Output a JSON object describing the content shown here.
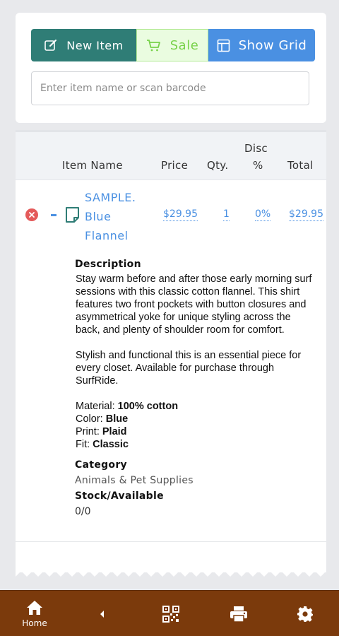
{
  "toolbar": {
    "new_item_label": "New Item",
    "sale_label": "Sale",
    "show_grid_label": "Show Grid"
  },
  "search": {
    "placeholder": "Enter item name or scan barcode"
  },
  "table": {
    "headers": {
      "item_name": "Item Name",
      "price": "Price",
      "qty": "Qty.",
      "disc_line1": "Disc",
      "disc_line2": "%",
      "total": "Total"
    },
    "row": {
      "name_line1": "SAMPLE.",
      "name_line2": "Blue",
      "name_line3": "Flannel",
      "price": "$29.95",
      "qty": "1",
      "discount": "0%",
      "total": "$29.95"
    }
  },
  "details": {
    "description_title": "Description",
    "description_p1": "Stay warm before and after those early morning surf sessions with this classic cotton flannel. This shirt features two front pockets with button closures and asymmetrical yoke for unique styling across the back, and plenty of shoulder room for comfort.",
    "description_p2": "Stylish and functional this is an essential piece for every closet. Available for purchase through SurfRide.",
    "attributes": [
      {
        "label": "Material:",
        "value": "100% cotton"
      },
      {
        "label": "Color:",
        "value": "Blue"
      },
      {
        "label": "Print:",
        "value": "Plaid"
      },
      {
        "label": "Fit:",
        "value": "Classic"
      }
    ],
    "category_title": "Category",
    "category_value": "Animals & Pet Supplies",
    "stock_title": "Stock/Available",
    "stock_value": "0/0"
  },
  "nav": {
    "home_label": "Home"
  },
  "colors": {
    "teal": "#2f7d76",
    "sale_green": "#78d24a",
    "blue": "#4a90e2",
    "nav_brown": "#7b3a0c",
    "remove_red": "#e45a5a"
  }
}
